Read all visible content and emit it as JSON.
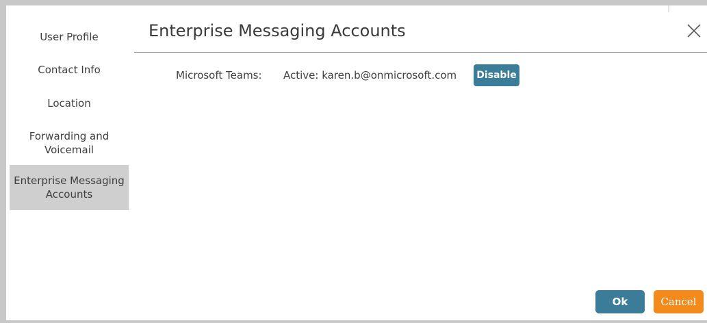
{
  "sidebar": {
    "items": [
      {
        "label": "User Profile",
        "active": false
      },
      {
        "label": "Contact Info",
        "active": false
      },
      {
        "label": "Location",
        "active": false
      },
      {
        "label": "Forwarding and\nVoicemail",
        "active": false
      },
      {
        "label": "Enterprise Messaging\nAccounts",
        "active": true
      }
    ]
  },
  "dialog": {
    "title": "Enterprise Messaging Accounts",
    "close_icon": "close-x-icon"
  },
  "account": {
    "service_label": "Microsoft Teams:",
    "status_text": "Active: karen.b@onmicrosoft.com",
    "disable_label": "Disable"
  },
  "footer": {
    "ok_label": "Ok",
    "cancel_label": "Cancel"
  },
  "colors": {
    "primary_button": "#3b7d98",
    "cancel_button": "#f28a1c",
    "active_sidebar": "#cfcfcf",
    "frame_border": "#c8c8c8"
  }
}
